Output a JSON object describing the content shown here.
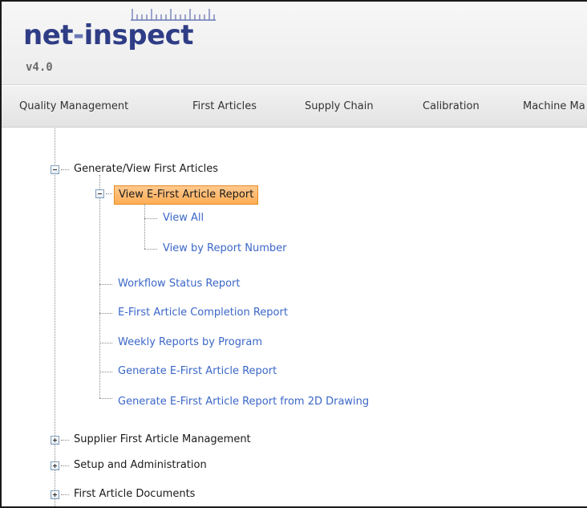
{
  "app": {
    "logo_text_main": "net",
    "logo_text_hyphen": "-",
    "logo_text_end": "inspect",
    "version": "v4.0"
  },
  "nav": {
    "items": [
      {
        "label": "Quality Management"
      },
      {
        "label": "First Articles"
      },
      {
        "label": "Supply Chain"
      },
      {
        "label": "Calibration"
      },
      {
        "label": "Machine Ma"
      }
    ]
  },
  "tree": {
    "generate_view": {
      "label": "Generate/View First Articles",
      "expanded": true
    },
    "view_report": {
      "label": "View E-First Article Report",
      "expanded": true,
      "selected": true
    },
    "view_all": {
      "label": "View All"
    },
    "view_by_number": {
      "label": "View by Report Number"
    },
    "workflow_status": {
      "label": "Workflow Status Report"
    },
    "completion_report": {
      "label": "E-First Article Completion Report"
    },
    "weekly_reports": {
      "label": "Weekly Reports by Program"
    },
    "generate_report": {
      "label": "Generate E-First Article Report"
    },
    "generate_from_2d": {
      "label": "Generate E-First Article Report from 2D Drawing"
    },
    "supplier_mgmt": {
      "label": "Supplier First Article Management",
      "expanded": false
    },
    "setup_admin": {
      "label": "Setup and Administration",
      "expanded": false
    },
    "fa_documents": {
      "label": "First Article Documents",
      "expanded": false
    }
  },
  "colors": {
    "logo_blue": "#2f3d86",
    "link_blue": "#3b67c8",
    "selected_bg": "#ffad55",
    "selected_border": "#e58a1e"
  }
}
